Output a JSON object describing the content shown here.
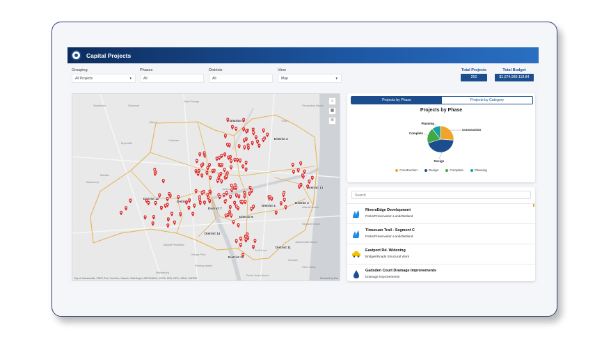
{
  "header": {
    "title": "Capital Projects"
  },
  "filters": [
    {
      "label": "Grouping",
      "value": "All Projects",
      "dropdown": true
    },
    {
      "label": "Phases",
      "value": "All",
      "dropdown": false
    },
    {
      "label": "Districts",
      "value": "All",
      "dropdown": false
    },
    {
      "label": "View",
      "value": "Map",
      "dropdown": true
    }
  ],
  "kpis": {
    "total_projects_label": "Total Projects",
    "total_projects_value": "252",
    "total_budget_label": "Total Budget",
    "total_budget_value": "$1,674,989,118.84"
  },
  "map": {
    "districts": [
      "District 2",
      "District 3",
      "District 4",
      "District 5",
      "District 6",
      "District 7",
      "District 9",
      "District 10",
      "District 11",
      "District 12",
      "District 13",
      "District 14"
    ],
    "places": [
      "Sanderson",
      "Dinsmore",
      "Saint George",
      "Hilliard",
      "Bryceville",
      "Baldwin",
      "Callahan",
      "Macclenny",
      "Middleburg",
      "Orange Park",
      "Oakleaf Plantation",
      "Fleming Island",
      "Ponte Vedra Beach",
      "Jacksonville Beach",
      "Neptune Beach",
      "Atlantic Beach",
      "Fernandina Beach",
      "Yulee",
      "Fruit Cove",
      "Jacksonville",
      "Nocatee",
      "Palm Valley"
    ],
    "marker_color": "#d42a2a",
    "attribution": "City of Jacksonville, FDEP, Esri, TomTom, Garmin, SafeGraph, METI/NASA, USGS, EPA, NPS, USDA, USFWS",
    "powered": "Powered by Esri",
    "controls": [
      "home-icon",
      "basemap-gallery-icon",
      "layers-icon"
    ]
  },
  "tabs": [
    {
      "label": "Projects by Phase",
      "active": true
    },
    {
      "label": "Projects by Category",
      "active": false
    }
  ],
  "chart_data": {
    "type": "pie",
    "title": "Projects by Phase",
    "categories": [
      "Construction",
      "Design",
      "Complete",
      "Planning"
    ],
    "values": [
      66,
      111,
      48,
      27
    ],
    "colors": [
      "#f0a52a",
      "#1c4e8e",
      "#43a843",
      "#1a9fa0"
    ],
    "legend": "bottom"
  },
  "list": {
    "search_placeholder": "Search",
    "items": [
      {
        "name": "RiversEdge Development",
        "category": "Parks/Preservation Land/Wetland",
        "icon": "park-icon"
      },
      {
        "name": "Timucuan Trail - Segment C",
        "category": "Parks/Preservation Land/Wetland",
        "icon": "park-icon"
      },
      {
        "name": "Eastport Rd. Widening",
        "category": "Bridges/Roads Structural Work",
        "icon": "car-icon"
      },
      {
        "name": "Gadsden Court Drainage Improvements",
        "category": "Drainage Improvements",
        "icon": "water-drop-icon"
      }
    ]
  }
}
